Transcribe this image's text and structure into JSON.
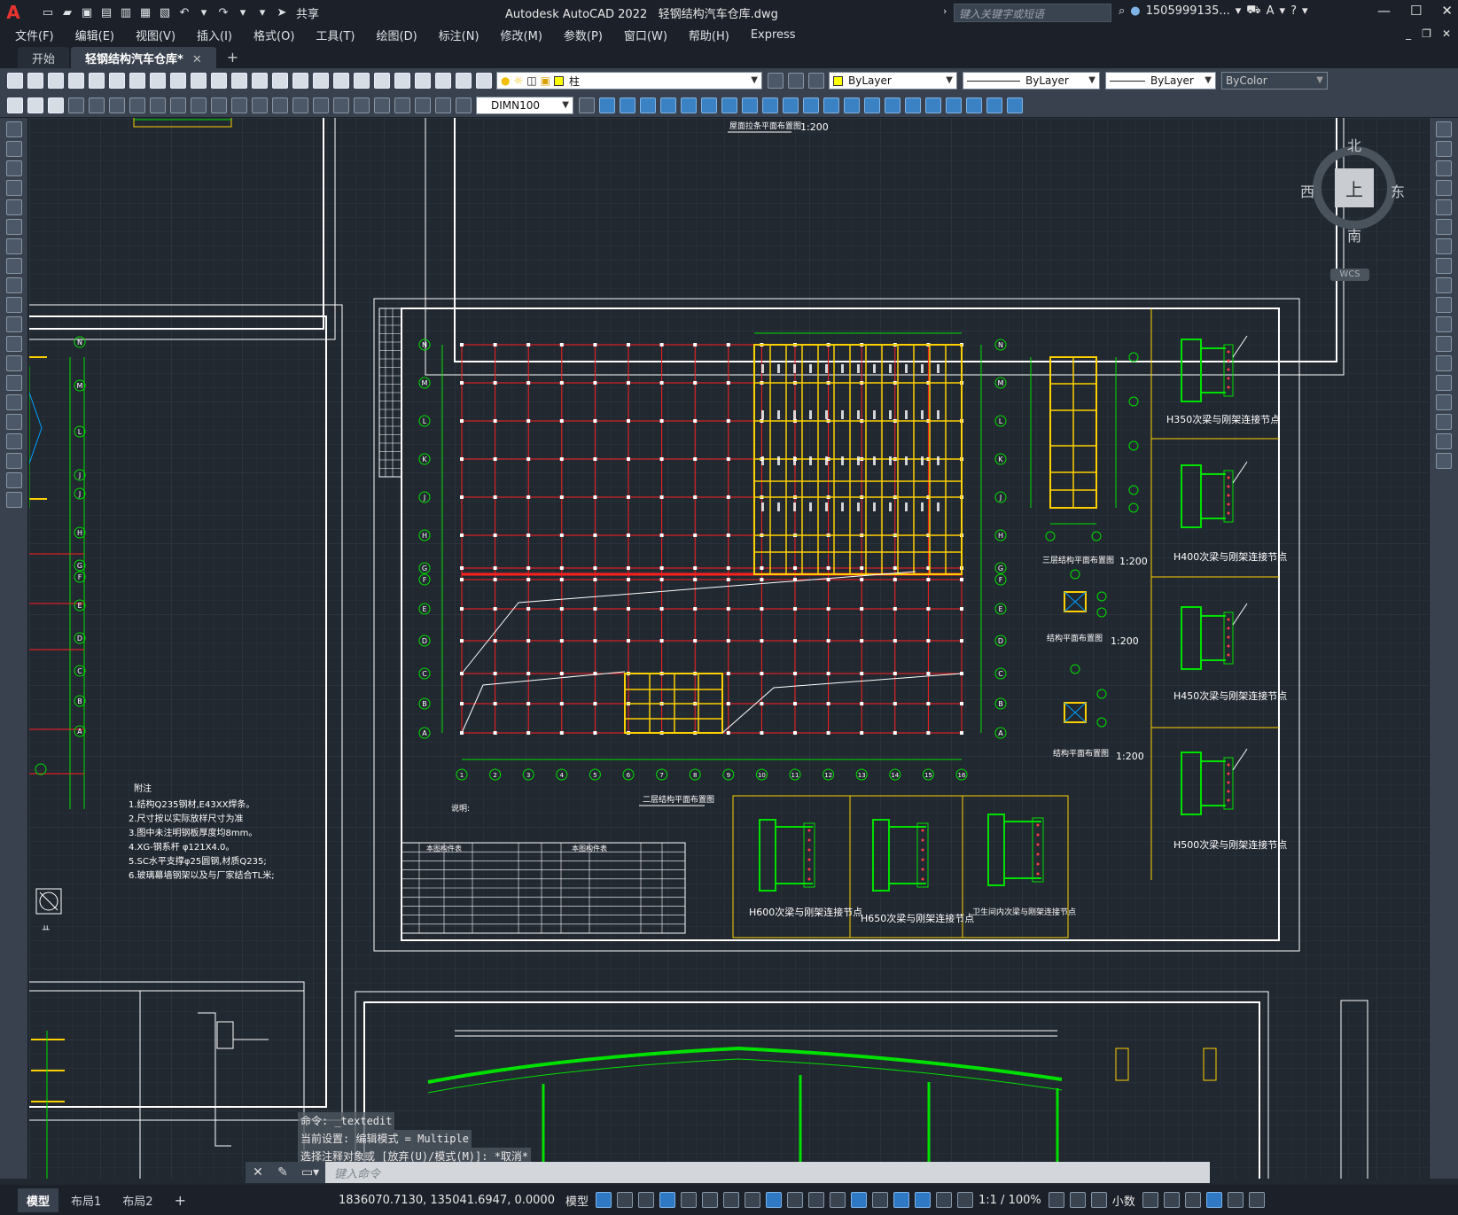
{
  "app": {
    "logo": "A",
    "title": "Autodesk AutoCAD 2022",
    "filename": "轻钢结构汽车仓库.dwg",
    "share_label": "共享",
    "search_placeholder": "键入关键字或短语",
    "user": "1505999135...",
    "help": "?"
  },
  "menu": [
    "文件(F)",
    "编辑(E)",
    "视图(V)",
    "插入(I)",
    "格式(O)",
    "工具(T)",
    "绘图(D)",
    "标注(N)",
    "修改(M)",
    "参数(P)",
    "窗口(W)",
    "帮助(H)",
    "Express"
  ],
  "file_tabs": [
    {
      "label": "开始",
      "active": false
    },
    {
      "label": "轻钢结构汽车仓库*",
      "active": true
    }
  ],
  "layer": {
    "name": "柱",
    "color": "#ffff00"
  },
  "properties": {
    "color": "ByLayer",
    "linetype": "ByLayer",
    "lineweight": "ByLayer",
    "plotstyle": "ByColor"
  },
  "dim_style": "DIMN100",
  "viewcube": {
    "top": "上",
    "north": "北",
    "south": "南",
    "east": "东",
    "west": "西",
    "wcs": "WCS"
  },
  "drawing": {
    "labels": [
      {
        "id": "roof-plan-title",
        "text": "屋面拉条平面布置图"
      },
      {
        "id": "roof-plan-scale",
        "text": "1:200"
      },
      {
        "id": "floor2-title",
        "text": "二层结构平面布置图"
      },
      {
        "id": "floor3-title",
        "text": "三层结构平面布置图"
      },
      {
        "id": "floor3-scale",
        "text": "1:200"
      },
      {
        "id": "struct1-title",
        "text": "结构平面布置图"
      },
      {
        "id": "struct1-scale",
        "text": "1:200"
      },
      {
        "id": "struct2-title",
        "text": "结构平面布置图"
      },
      {
        "id": "struct2-scale",
        "text": "1:200"
      },
      {
        "id": "node-h350",
        "text": "H350次梁与刚架连接节点"
      },
      {
        "id": "node-h400",
        "text": "H400次梁与刚架连接节点"
      },
      {
        "id": "node-h450",
        "text": "H450次梁与刚架连接节点"
      },
      {
        "id": "node-h500",
        "text": "H500次梁与刚架连接节点"
      },
      {
        "id": "node-h600",
        "text": "H600次梁与刚架连接节点"
      },
      {
        "id": "node-h650",
        "text": "H650次梁与刚架连接节点"
      },
      {
        "id": "node-wc",
        "text": "卫生间内次梁与刚架连接节点"
      },
      {
        "id": "notes-label",
        "text": "说明:"
      },
      {
        "id": "note-left-title",
        "text": "附注"
      }
    ],
    "notes_left": [
      "1.结构Q235钢材,E43XX焊条。",
      "2.尺寸按以实际放样尺寸为准",
      "3.图中未注明钢板厚度均8mm。",
      "4.XG-钢系杆 φ121X4.0。",
      "5.SC水平支撑φ25圆钢,材质Q235;",
      "6.玻璃幕墙钢架以及与厂家结合TL米;"
    ],
    "axis_rows": [
      "N",
      "M",
      "L",
      "K",
      "J",
      "H",
      "G",
      "F",
      "E",
      "D",
      "C",
      "B",
      "A"
    ],
    "axis_cols": [
      "1",
      "2",
      "3",
      "4",
      "5",
      "6",
      "7",
      "8",
      "9",
      "10",
      "11",
      "12",
      "13",
      "14",
      "15",
      "16"
    ],
    "left_axis_rows": [
      "N",
      "M",
      "L",
      "J",
      "J",
      "H",
      "G",
      "F",
      "E",
      "D",
      "C",
      "B",
      "A"
    ],
    "steel_table_title": "本图构件表"
  },
  "command": {
    "history": [
      "命令:  _textedit",
      "当前设置: 编辑模式 = Multiple",
      "选择注释对象或 [放弃(U)/模式(M)]: *取消*"
    ],
    "placeholder": "键入命令"
  },
  "layout_tabs": [
    {
      "label": "模型",
      "active": true
    },
    {
      "label": "布局1",
      "active": false
    },
    {
      "label": "布局2",
      "active": false
    }
  ],
  "status": {
    "coords": "1836070.7130, 135041.6947, 0.0000",
    "mode": "模型",
    "scale": "1:1 / 100%",
    "units": "小数"
  },
  "colors": {
    "canvas_bg": "#212830",
    "grid_red": "#ff2020",
    "beam_yellow": "#ffd000",
    "axis_green": "#00e000",
    "frame_white": "#ffffff"
  }
}
